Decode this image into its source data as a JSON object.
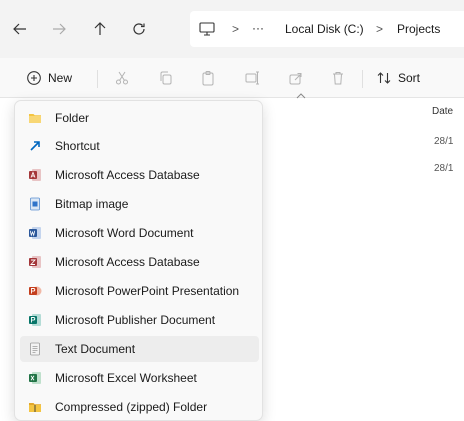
{
  "address": {
    "breadcrumbs": [
      "Local Disk (C:)",
      "Projects"
    ],
    "ellipsis": "···",
    "separator": ">"
  },
  "commandbar": {
    "new_label": "New",
    "sort_label": "Sort"
  },
  "filelist": {
    "date_header": "Date",
    "rows": [
      "28/1",
      "28/1"
    ]
  },
  "new_menu": {
    "items": [
      {
        "label": "Folder",
        "icon": "folder-icon"
      },
      {
        "label": "Shortcut",
        "icon": "shortcut-icon"
      },
      {
        "label": "Microsoft Access Database",
        "icon": "access-icon"
      },
      {
        "label": "Bitmap image",
        "icon": "bitmap-icon"
      },
      {
        "label": "Microsoft Word Document",
        "icon": "word-icon"
      },
      {
        "label": "Microsoft Access Database",
        "icon": "access-icon"
      },
      {
        "label": "Microsoft PowerPoint Presentation",
        "icon": "powerpoint-icon"
      },
      {
        "label": "Microsoft Publisher Document",
        "icon": "publisher-icon"
      },
      {
        "label": "Text Document",
        "icon": "text-document-icon"
      },
      {
        "label": "Microsoft Excel Worksheet",
        "icon": "excel-icon"
      },
      {
        "label": "Compressed (zipped) Folder",
        "icon": "zip-folder-icon"
      }
    ],
    "highlighted_item": "Text Document"
  },
  "colors": {
    "access": "#a4373a",
    "word": "#2b579a",
    "powerpoint": "#c43e1c",
    "publisher": "#077568",
    "excel": "#217346",
    "folder": "#f4c542",
    "shortcut": "#0067c0"
  }
}
